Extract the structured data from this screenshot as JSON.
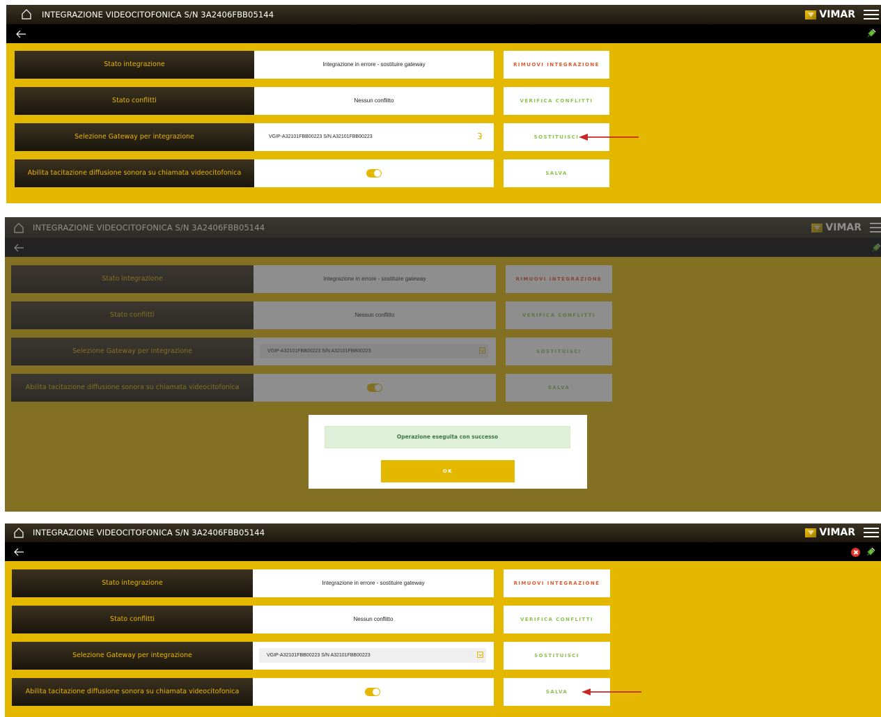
{
  "header": {
    "title": "INTEGRAZIONE VIDEOCITOFONICA S/N 3A2406FBB05144",
    "logo_text": "VIMAR"
  },
  "rows": {
    "stato_integrazione": {
      "label": "Stato integrazione",
      "value": "Integrazione in errore - sostituire gateway",
      "button": "RIMUOVI INTEGRAZIONE"
    },
    "stato_conflitti": {
      "label": "Stato conflitti",
      "value": "Nessun conflitto",
      "button": "VERIFICA CONFLITTI"
    },
    "gateway": {
      "label": "Selezione Gateway per integrazione",
      "selected": "VGIP-A32101FBB00223 S/N A32101FBB00223",
      "button": "SOSTITUISCI"
    },
    "tacitazione": {
      "label": "Abilita tacitazione diffusione sonora su chiamata videocitofonica",
      "toggle_on": true,
      "button": "SALVA"
    }
  },
  "dialog": {
    "message": "Operazione eseguita con successo",
    "ok_label": "OK"
  },
  "colors": {
    "accent": "#e5b800",
    "danger": "#e4572e",
    "success": "#8bc34a",
    "annotation_arrow": "#c62828"
  },
  "icons": [
    "home-icon",
    "menu-icon",
    "back-arrow-icon",
    "plug-icon",
    "error-icon",
    "chevron-down-icon"
  ]
}
